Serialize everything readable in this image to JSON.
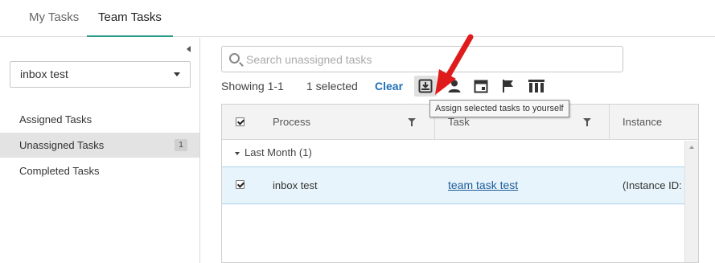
{
  "tabs": [
    {
      "label": "My Tasks",
      "active": false
    },
    {
      "label": "Team Tasks",
      "active": true
    }
  ],
  "sidebar": {
    "team_select": {
      "value": "inbox test"
    },
    "items": [
      {
        "label": "Assigned Tasks"
      },
      {
        "label": "Unassigned Tasks",
        "count": "1",
        "active": true
      },
      {
        "label": "Completed Tasks"
      }
    ]
  },
  "search": {
    "placeholder": "Search unassigned tasks",
    "value": ""
  },
  "status": {
    "showing": "Showing 1-1",
    "selected": "1 selected",
    "clear": "Clear"
  },
  "toolbar": {
    "icons": [
      "assign-to-me-icon",
      "person-icon",
      "calendar-icon",
      "flag-icon",
      "columns-icon"
    ],
    "tooltip": "Assign selected tasks to yourself"
  },
  "grid": {
    "columns": [
      "Process",
      "Task",
      "Instance"
    ],
    "group": {
      "label": "Last Month (1)"
    },
    "rows": [
      {
        "checked": true,
        "process": "inbox test",
        "task": "team task test",
        "instance": "(Instance ID:"
      }
    ]
  },
  "colors": {
    "accent_tab": "#2a9a8a",
    "link": "#1d5c9a",
    "selected_row": "#e8f4fb",
    "arrow": "#e01b1b"
  }
}
